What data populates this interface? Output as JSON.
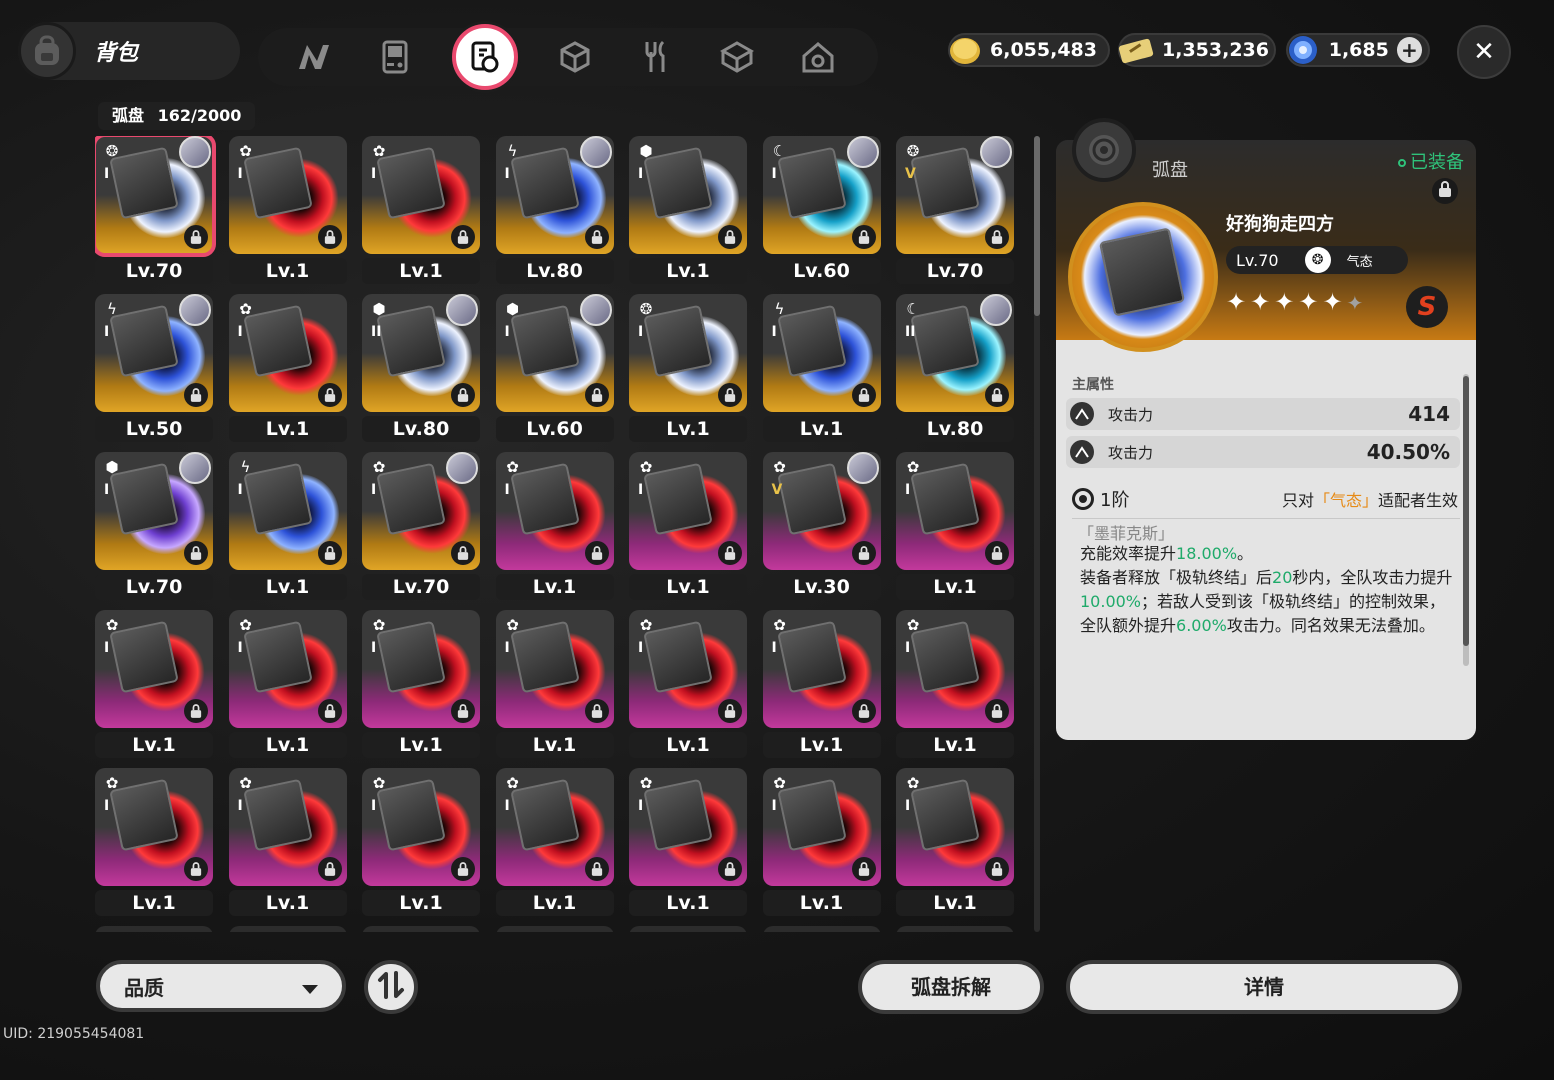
{
  "header": {
    "bag_label": "背包",
    "categories": [
      {
        "name": "agent-tab",
        "icon": "n-logo-icon"
      },
      {
        "name": "gameboy-tab",
        "icon": "handheld-console-icon"
      },
      {
        "name": "disc-tab",
        "icon": "disc-drive-icon",
        "active": true
      },
      {
        "name": "cube-tab",
        "icon": "cube-icon"
      },
      {
        "name": "food-tab",
        "icon": "fork-knife-icon"
      },
      {
        "name": "material-tab",
        "icon": "box-icon"
      },
      {
        "name": "home-tab",
        "icon": "home-icon"
      }
    ],
    "currencies": [
      {
        "icon": "gold-coin-icon",
        "value": "6,055,483"
      },
      {
        "icon": "ticket-icon",
        "value": "1,353,236"
      },
      {
        "icon": "polychrome-icon",
        "value": "1,685"
      }
    ],
    "close": "✕"
  },
  "inventory": {
    "label": "弧盘",
    "count": "162/2000"
  },
  "grid": [
    {
      "type": "swirl",
      "rank": "I",
      "avatar": true,
      "rarity": "gold",
      "theme": "white",
      "level": "Lv.70",
      "selected": true
    },
    {
      "type": "gear",
      "rank": "I",
      "avatar": false,
      "rarity": "gold",
      "theme": "red",
      "level": "Lv.1"
    },
    {
      "type": "gear",
      "rank": "I",
      "avatar": false,
      "rarity": "gold",
      "theme": "red",
      "level": "Lv.1"
    },
    {
      "type": "bolt",
      "rank": "I",
      "avatar": true,
      "rarity": "gold",
      "theme": "blue",
      "level": "Lv.80"
    },
    {
      "type": "cube",
      "rank": "I",
      "avatar": false,
      "rarity": "gold",
      "theme": "white",
      "level": "Lv.1"
    },
    {
      "type": "moon",
      "rank": "I",
      "avatar": true,
      "rarity": "gold",
      "theme": "cyan",
      "level": "Lv.60"
    },
    {
      "type": "swirl",
      "rank": "V",
      "avatar": true,
      "rarity": "gold",
      "theme": "white",
      "level": "Lv.70"
    },
    {
      "type": "bolt",
      "rank": "I",
      "avatar": true,
      "rarity": "gold",
      "theme": "blue",
      "level": "Lv.50"
    },
    {
      "type": "gear",
      "rank": "I",
      "avatar": false,
      "rarity": "gold",
      "theme": "red",
      "level": "Lv.1"
    },
    {
      "type": "cube",
      "rank": "II",
      "avatar": true,
      "rarity": "gold",
      "theme": "white",
      "level": "Lv.80"
    },
    {
      "type": "cube",
      "rank": "I",
      "avatar": true,
      "rarity": "gold",
      "theme": "white",
      "level": "Lv.60"
    },
    {
      "type": "swirl",
      "rank": "I",
      "avatar": false,
      "rarity": "gold",
      "theme": "white",
      "level": "Lv.1"
    },
    {
      "type": "bolt",
      "rank": "I",
      "avatar": false,
      "rarity": "gold",
      "theme": "blue",
      "level": "Lv.1"
    },
    {
      "type": "moon",
      "rank": "II",
      "avatar": true,
      "rarity": "gold",
      "theme": "cyan",
      "level": "Lv.80"
    },
    {
      "type": "cube",
      "rank": "I",
      "avatar": true,
      "rarity": "gold",
      "theme": "purple",
      "level": "Lv.70"
    },
    {
      "type": "bolt",
      "rank": "I",
      "avatar": false,
      "rarity": "gold",
      "theme": "blue",
      "level": "Lv.1"
    },
    {
      "type": "gear",
      "rank": "I",
      "avatar": true,
      "rarity": "gold",
      "theme": "red",
      "level": "Lv.70"
    },
    {
      "type": "gear",
      "rank": "I",
      "avatar": false,
      "rarity": "pink",
      "theme": "red",
      "level": "Lv.1"
    },
    {
      "type": "gear",
      "rank": "I",
      "avatar": false,
      "rarity": "pink",
      "theme": "red",
      "level": "Lv.1"
    },
    {
      "type": "gear",
      "rank": "V",
      "avatar": true,
      "rarity": "pink",
      "theme": "red",
      "level": "Lv.30"
    },
    {
      "type": "gear",
      "rank": "I",
      "avatar": false,
      "rarity": "pink",
      "theme": "red",
      "level": "Lv.1"
    },
    {
      "type": "gear",
      "rank": "I",
      "avatar": false,
      "rarity": "pink",
      "theme": "red",
      "level": "Lv.1"
    },
    {
      "type": "gear",
      "rank": "I",
      "avatar": false,
      "rarity": "pink",
      "theme": "red",
      "level": "Lv.1"
    },
    {
      "type": "gear",
      "rank": "I",
      "avatar": false,
      "rarity": "pink",
      "theme": "red",
      "level": "Lv.1"
    },
    {
      "type": "gear",
      "rank": "I",
      "avatar": false,
      "rarity": "pink",
      "theme": "red",
      "level": "Lv.1"
    },
    {
      "type": "gear",
      "rank": "I",
      "avatar": false,
      "rarity": "pink",
      "theme": "red",
      "level": "Lv.1"
    },
    {
      "type": "gear",
      "rank": "I",
      "avatar": false,
      "rarity": "pink",
      "theme": "red",
      "level": "Lv.1"
    },
    {
      "type": "gear",
      "rank": "I",
      "avatar": false,
      "rarity": "pink",
      "theme": "red",
      "level": "Lv.1"
    },
    {
      "type": "gear",
      "rank": "I",
      "avatar": false,
      "rarity": "pink",
      "theme": "red",
      "level": "Lv.1"
    },
    {
      "type": "gear",
      "rank": "I",
      "avatar": false,
      "rarity": "pink",
      "theme": "red",
      "level": "Lv.1"
    },
    {
      "type": "gear",
      "rank": "I",
      "avatar": false,
      "rarity": "pink",
      "theme": "red",
      "level": "Lv.1"
    },
    {
      "type": "gear",
      "rank": "I",
      "avatar": false,
      "rarity": "pink",
      "theme": "red",
      "level": "Lv.1"
    },
    {
      "type": "gear",
      "rank": "I",
      "avatar": false,
      "rarity": "pink",
      "theme": "red",
      "level": "Lv.1"
    },
    {
      "type": "gear",
      "rank": "I",
      "avatar": false,
      "rarity": "pink",
      "theme": "red",
      "level": "Lv.1"
    },
    {
      "type": "gear",
      "rank": "I",
      "avatar": false,
      "rarity": "pink",
      "theme": "red",
      "level": "Lv.1"
    }
  ],
  "bottom": {
    "filter_label": "品质",
    "dismantle_label": "弧盘拆解",
    "details_label": "详情",
    "uid": "UID: 219055454081"
  },
  "detail": {
    "section": "弧盘",
    "equipped": "已装备",
    "name": "好狗狗走四方",
    "level": "Lv.70",
    "type_name": "气态",
    "stars_filled": 5,
    "stars_total": 6,
    "grade": "S",
    "main_attr_title": "主属性",
    "stats": [
      {
        "name": "攻击力",
        "value": "414"
      },
      {
        "name": "攻击力",
        "value": "40.50%"
      }
    ],
    "tier": "1阶",
    "condition_prefix": "只对",
    "condition_highlight": "「气态」",
    "condition_suffix": "适配者生效",
    "effect_name": "「墨菲克斯」",
    "effect_parts": [
      {
        "t": "充能效率提升",
        "g": false
      },
      {
        "t": "18.00%",
        "g": true
      },
      {
        "t": "。",
        "g": false
      },
      {
        "t": "\n装备者释放「极轨终结」后",
        "g": false
      },
      {
        "t": "20",
        "g": true
      },
      {
        "t": "秒内，全队攻击力提升",
        "g": false
      },
      {
        "t": "10.00%",
        "g": true
      },
      {
        "t": "；若敌人受到该「极轨终结」的控制效果，全队额外提升",
        "g": false
      },
      {
        "t": "6.00%",
        "g": true
      },
      {
        "t": "攻击力。同名效果无法叠加。",
        "g": false
      }
    ]
  }
}
